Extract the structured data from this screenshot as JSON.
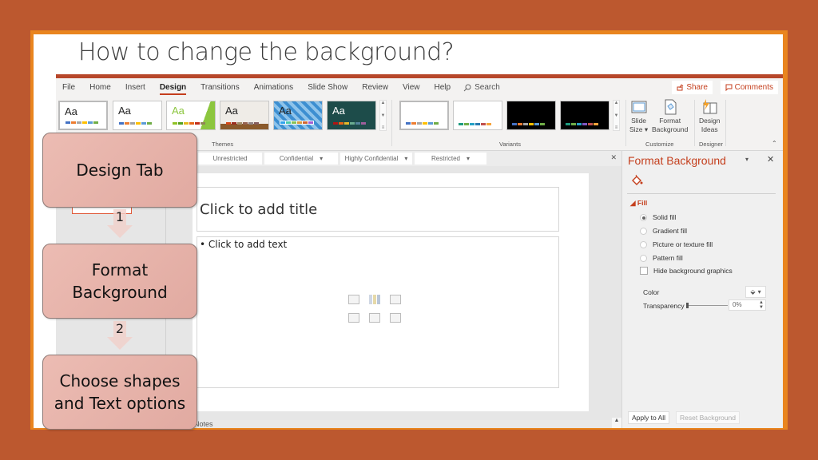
{
  "slide": {
    "title": "How to change the background?"
  },
  "menu": {
    "items": [
      "File",
      "Home",
      "Insert",
      "Design",
      "Transitions",
      "Animations",
      "Slide Show",
      "Review",
      "View",
      "Help"
    ],
    "active": "Design",
    "search_label": "Search",
    "share_label": "Share",
    "comments_label": "Comments"
  },
  "ribbon": {
    "themes_label": "Themes",
    "variants_label": "Variants",
    "customize_label": "Customize",
    "designer_label": "Designer",
    "theme_aa": "Aa",
    "slide_size": {
      "line1": "Slide",
      "line2": "Size ▾"
    },
    "format_background": {
      "line1": "Format",
      "line2": "Background"
    },
    "design_ideas": {
      "line1": "Design",
      "line2": "Ideas"
    }
  },
  "sensitivity": {
    "labels": [
      "Unrestricted",
      "Confidential",
      "Highly Confidential",
      "Restricted"
    ]
  },
  "editor": {
    "title_placeholder": "Click to add title",
    "body_placeholder": "• Click to add text",
    "notes_label": "Notes"
  },
  "format_pane": {
    "title": "Format Background",
    "section": "Fill",
    "options": [
      {
        "label": "Solid fill",
        "selected": true
      },
      {
        "label": "Gradient fill",
        "selected": false
      },
      {
        "label": "Picture or texture fill",
        "selected": false
      },
      {
        "label": "Pattern fill",
        "selected": false
      }
    ],
    "hide_graphics_label": "Hide background graphics",
    "hide_graphics_checked": false,
    "color_label": "Color",
    "transparency_label": "Transparency",
    "transparency_value": "0%",
    "apply_all_label": "Apply to All",
    "reset_label": "Reset Background"
  },
  "steps": [
    {
      "label": "Design Tab"
    },
    {
      "label": "Format Background"
    },
    {
      "label": "Choose shapes and Text options"
    }
  ],
  "step_numbers": [
    "1",
    "2"
  ],
  "colors": {
    "outer_bg": "#bc582f",
    "frame": "#e9851f",
    "accent": "#c43e1c",
    "step_box": "#e6b1a8"
  }
}
